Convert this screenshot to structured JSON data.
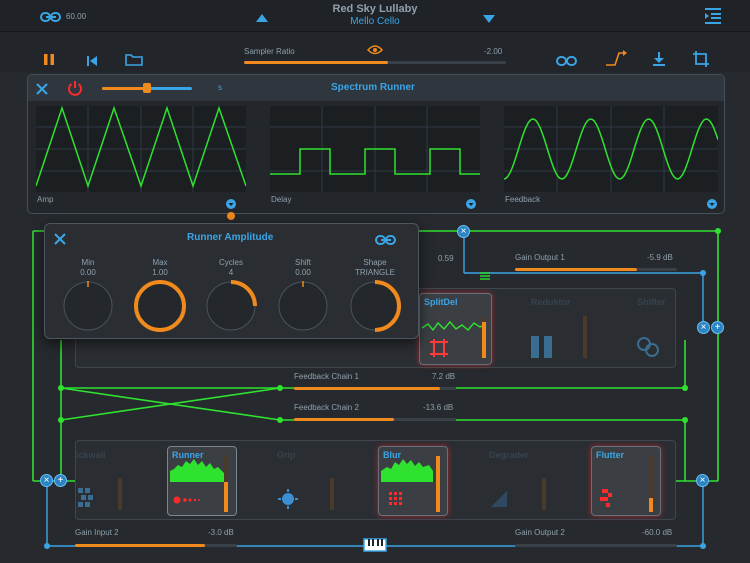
{
  "header": {
    "link_value": "60.00",
    "song_title": "Red Sky Lullaby",
    "preset_name": "Mello Cello"
  },
  "toolbar": {
    "sampler_ratio_label": "Sampler Ratio",
    "sampler_ratio_value": "-2.00",
    "sampler_ratio_fraction": 0.55
  },
  "spectrum_runner": {
    "title": "Spectrum Runner",
    "speed_unit": "s",
    "speed_fraction": 0.5,
    "scopes": [
      {
        "label": "Amp",
        "wave": "triangle"
      },
      {
        "label": "Delay",
        "wave": "square"
      },
      {
        "label": "Feedback",
        "wave": "sine"
      }
    ]
  },
  "runner_amplitude": {
    "title": "Runner Amplitude",
    "knobs": [
      {
        "name": "Min",
        "value": "0.00",
        "level": 0.0
      },
      {
        "name": "Max",
        "value": "1.00",
        "level": 1.0
      },
      {
        "name": "Cycles",
        "value": "4",
        "level": 0.25
      },
      {
        "name": "Shift",
        "value": "0.00",
        "level": 0.0
      },
      {
        "name": "Shape",
        "value": "TRIANGLE",
        "level": 0.5
      }
    ]
  },
  "chain": {
    "mix_value": "0.59",
    "gain_output_1": {
      "label": "Gain Output 1",
      "value": "-5.9 dB",
      "fraction": 0.75
    },
    "feedback_chain_1": {
      "label": "Feedback Chain 1",
      "value": "7.2 dB",
      "fraction": 0.9
    },
    "feedback_chain_2": {
      "label": "Feedback Chain 2",
      "value": "-13.6 dB",
      "fraction": 0.62
    },
    "gain_input_2": {
      "label": "Gain Input 2",
      "value": "-3.0 dB",
      "fraction": 0.8
    },
    "gain_output_2": {
      "label": "Gain Output 2",
      "value": "-60.0 dB",
      "fraction": 0.0
    }
  },
  "modules_top": [
    "SplitDel",
    "Reduktor",
    "Shifter"
  ],
  "modules_bottom": [
    "ickwall",
    "Runner",
    "Grip",
    "Blur",
    "Degrader",
    "Flutter"
  ],
  "colors": {
    "accent": "#3aa5e6",
    "orange": "#f08a1c",
    "signal": "#2fe22f",
    "alert": "#ff2a2a"
  }
}
